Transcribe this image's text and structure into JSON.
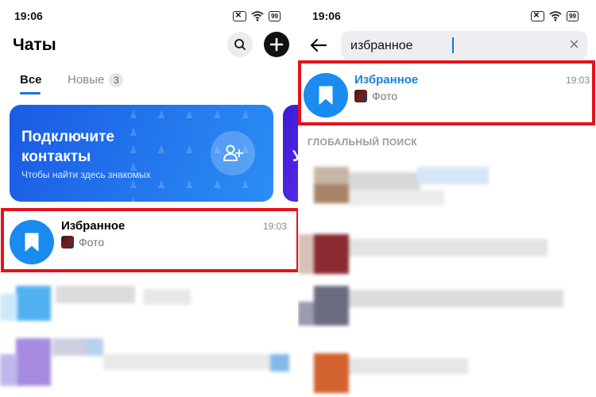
{
  "status": {
    "time": "19:06",
    "battery": "99"
  },
  "left": {
    "title": "Чаты",
    "tabs": [
      {
        "label": "Все"
      },
      {
        "label": "Новые",
        "badge": "3"
      }
    ],
    "banner": {
      "title": "Подключите контакты",
      "subtitle": "Чтобы найти здесь знакомых",
      "next_letter": "У"
    },
    "chat": {
      "name": "Избранное",
      "time": "19:03",
      "preview": "Фото"
    }
  },
  "right": {
    "search_value": "избранное",
    "result": {
      "name": "Избранное",
      "time": "19:03",
      "preview": "Фото"
    },
    "section_label": "ГЛОБАЛЬНЫЙ ПОИСК"
  },
  "colors": {
    "accent": "#1a8bef",
    "highlight": "#e3131b",
    "banner": "#1a5be3"
  },
  "icons": [
    "search-icon",
    "plus-icon",
    "add-contact-icon",
    "bookmark-icon",
    "back-arrow-icon",
    "clear-icon",
    "wifi-icon",
    "battery-icon"
  ]
}
